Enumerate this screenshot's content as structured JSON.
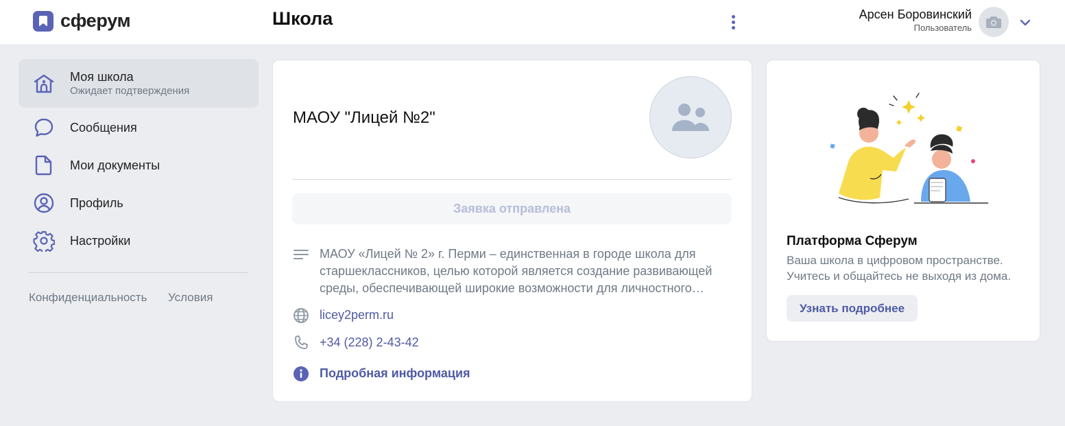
{
  "header": {
    "logo_text": "сферум",
    "title": "Школа",
    "user": {
      "name": "Арсен Боровинский",
      "role": "Пользователь"
    }
  },
  "sidebar": {
    "items": [
      {
        "label": "Моя школа",
        "sub": "Ожидает подтверждения",
        "icon": "school-icon",
        "active": true
      },
      {
        "label": "Сообщения",
        "icon": "chat-icon"
      },
      {
        "label": "Мои документы",
        "icon": "document-icon"
      },
      {
        "label": "Профиль",
        "icon": "profile-icon"
      },
      {
        "label": "Настройки",
        "icon": "gear-icon"
      }
    ],
    "footer": {
      "privacy": "Конфиденциальность",
      "terms": "Условия"
    }
  },
  "school": {
    "name": "МАОУ \"Лицей №2\"",
    "status_button": "Заявка отправлена",
    "description": "МАОУ «Лицей № 2» г. Перми – единственная в городе школа для старшеклассников, целью которой является создание развивающей среды, обеспечивающей широкие возможности для личностного…",
    "website": "licey2perm.ru",
    "phone": "+34 (228) 2-43-42",
    "more_info": "Подробная информация"
  },
  "promo": {
    "title": "Платформа Сферум",
    "text": "Ваша школа в цифровом пространстве. Учитесь и общайтесь не выходя из дома.",
    "button": "Узнать подробнее"
  },
  "colors": {
    "accent": "#5a63b5",
    "link": "#4f5aa3",
    "background": "#ebedf0"
  }
}
